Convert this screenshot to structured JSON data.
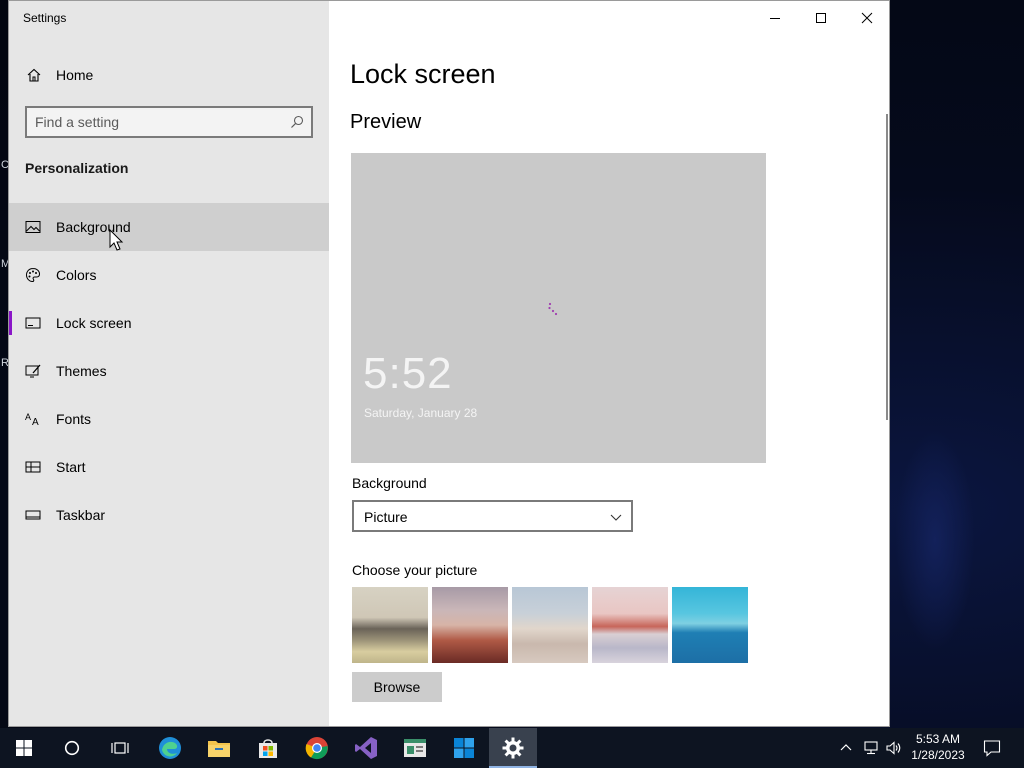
{
  "window": {
    "title": "Settings",
    "controls": {
      "minimize": "minimize",
      "maximize": "maximize",
      "close": "close"
    }
  },
  "sidebar": {
    "home_label": "Home",
    "search_placeholder": "Find a setting",
    "section_title": "Personalization",
    "items": [
      {
        "label": "Background",
        "icon": "picture-icon"
      },
      {
        "label": "Colors",
        "icon": "palette-icon"
      },
      {
        "label": "Lock screen",
        "icon": "lock-screen-icon"
      },
      {
        "label": "Themes",
        "icon": "themes-icon"
      },
      {
        "label": "Fonts",
        "icon": "fonts-icon"
      },
      {
        "label": "Start",
        "icon": "start-icon"
      },
      {
        "label": "Taskbar",
        "icon": "taskbar-icon"
      }
    ],
    "selected_item": "Lock screen",
    "hovered_item": "Background"
  },
  "main": {
    "page_title": "Lock screen",
    "preview_heading": "Preview",
    "preview": {
      "time": "5:52",
      "date": "Saturday, January 28"
    },
    "background_label": "Background",
    "background_value": "Picture",
    "choose_label": "Choose your picture",
    "selected_picture": 2,
    "browse_label": "Browse"
  },
  "taskbar": {
    "apps": [
      "start-icon",
      "search-icon",
      "task-view-icon",
      "edge-icon",
      "file-explorer-icon",
      "store-icon",
      "chrome-icon",
      "visual-studio-icon",
      "app-icon",
      "windows-app-icon",
      "settings-icon"
    ],
    "active_app": "settings-icon",
    "clock_time": "5:53 AM",
    "clock_date": "1/28/2023"
  },
  "colors": {
    "accent": "#8a16c8",
    "sidebar_bg": "#e6e6e6",
    "taskbar_bg": "#0d1421"
  }
}
